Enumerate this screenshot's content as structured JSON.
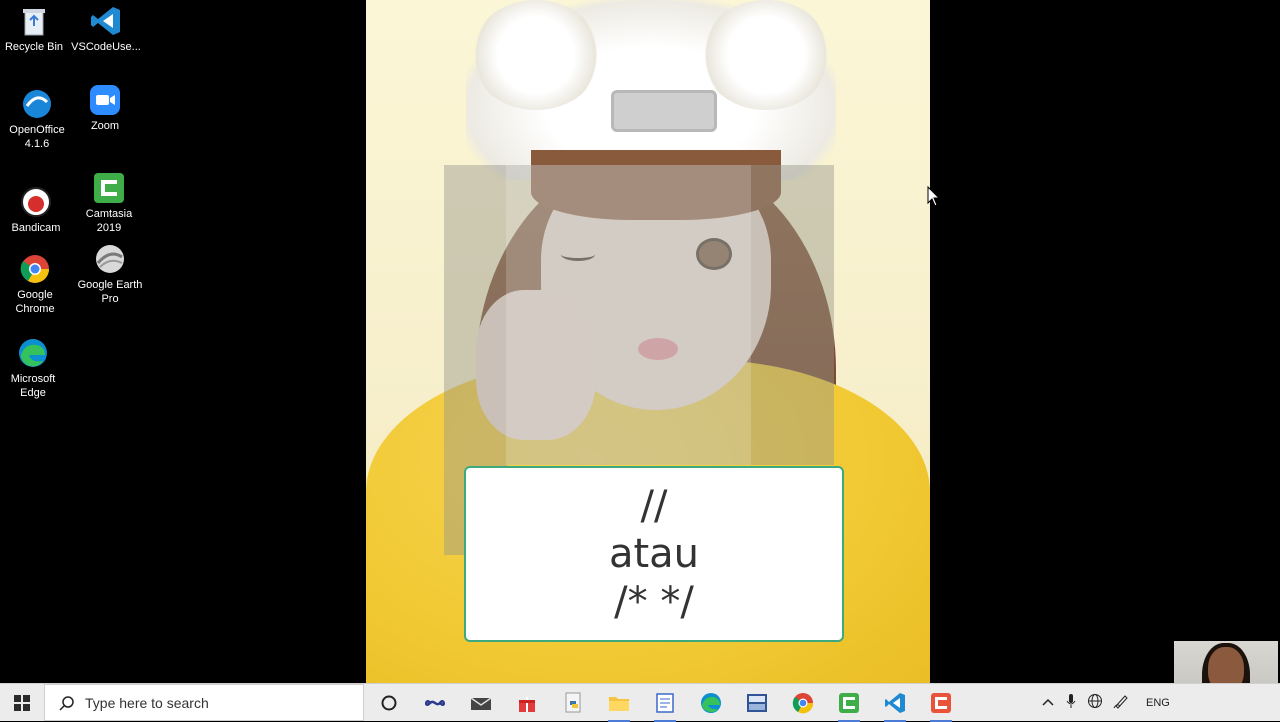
{
  "desktop": {
    "icons": [
      {
        "label": "Recycle Bin"
      },
      {
        "label": "VSCodeUse..."
      },
      {
        "label": "OpenOffice\n4.1.6"
      },
      {
        "label": "Zoom"
      },
      {
        "label": "Bandicam"
      },
      {
        "label": "Camtasia\n2019"
      },
      {
        "label": "Google\nChrome"
      },
      {
        "label": "Google Earth\nPro"
      },
      {
        "label": "Microsoft\nEdge"
      }
    ]
  },
  "slide": {
    "line1": "//",
    "line2": "atau",
    "line3": "/* */"
  },
  "taskbar": {
    "search_placeholder": "Type here to search",
    "language": "ENG",
    "pinned": [
      "cortana-icon",
      "task-view-icon",
      "mail-icon",
      "gift-icon",
      "python-icon",
      "file-explorer-icon",
      "notepad-icon",
      "edge-icon",
      "dev-cpp-icon",
      "chrome-icon",
      "camtasia-icon",
      "vscode-icon",
      "camtasia-recorder-icon"
    ]
  },
  "colors": {
    "textbox_border": "#3fa97e",
    "taskbar_bg": "#ececec",
    "active_indicator": "#4b7bd6"
  }
}
